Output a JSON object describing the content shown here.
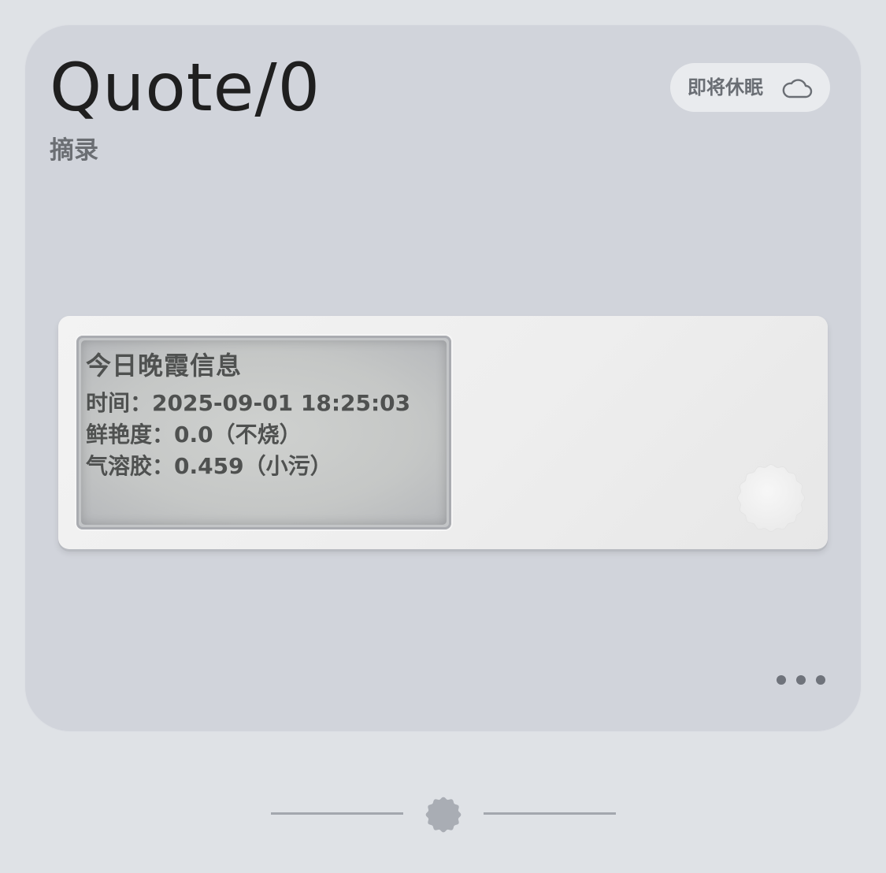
{
  "card": {
    "title": "Quote/0",
    "subtitle": "摘录",
    "status": {
      "label": "即将休眠",
      "icon": "cloud-icon"
    }
  },
  "device_screen": {
    "heading": "今日晚霞信息",
    "lines": [
      "时间：2025-09-01 18:25:03",
      "鲜艳度：0.0（不烧）",
      "气溶胶：0.459（小污）"
    ]
  },
  "more_menu": {
    "icon": "more-dots-icon"
  },
  "pager": {
    "active_indicator": "gear-dot"
  },
  "colors": {
    "background": "#dfe2e6",
    "card": "#d1d4db",
    "eink_text": "#4f5150",
    "muted_text": "#6b6e73"
  }
}
